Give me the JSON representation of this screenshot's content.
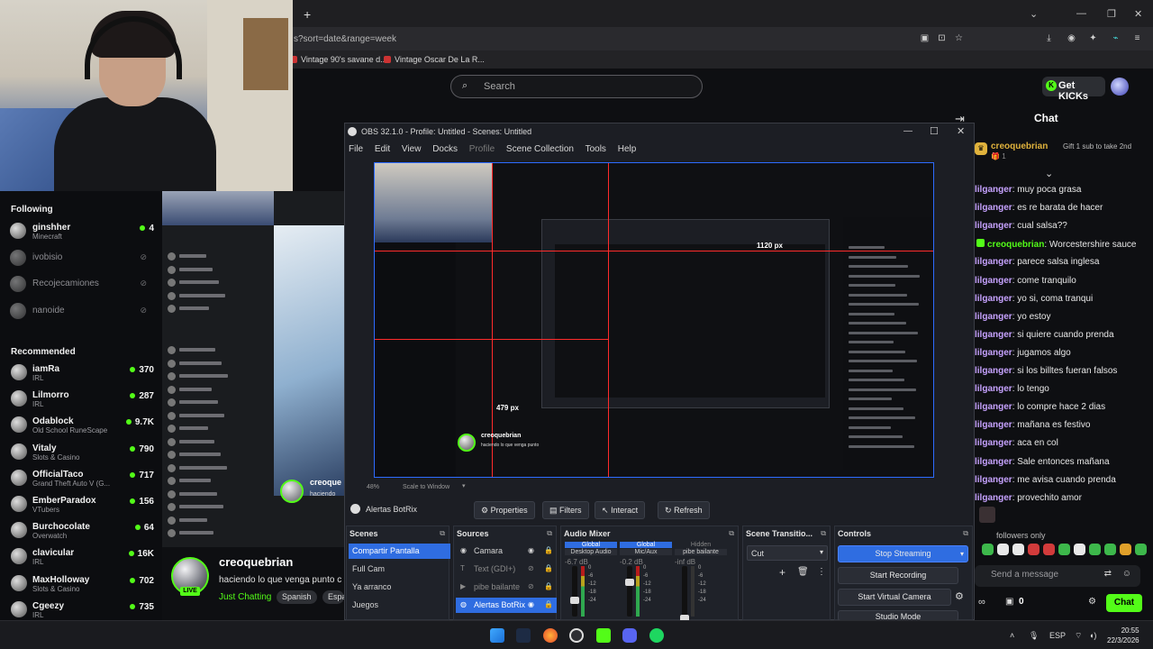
{
  "browser": {
    "url_fragment": "s?sort=date&range=week",
    "bookmarks": [
      "Vintage 90's savane d...",
      "Vintage Oscar De La R..."
    ],
    "new_tab": "+"
  },
  "header": {
    "search_placeholder": "Search",
    "get_kicks_label": "Get KICKs"
  },
  "sidebar": {
    "following_heading": "Following",
    "following": [
      {
        "name": "ginshher",
        "category": "Minecraft",
        "viewers": "4",
        "live": true
      },
      {
        "name": "ivobisio",
        "category": "",
        "viewers": "",
        "live": false
      },
      {
        "name": "Recojecamiones",
        "category": "",
        "viewers": "",
        "live": false
      },
      {
        "name": "nanoide",
        "category": "",
        "viewers": "",
        "live": false
      }
    ],
    "recommended_heading": "Recommended",
    "recommended": [
      {
        "name": "iamRa",
        "category": "IRL",
        "viewers": "370"
      },
      {
        "name": "Lilmorro",
        "category": "IRL",
        "viewers": "287"
      },
      {
        "name": "Odablock",
        "category": "Old School RuneScape",
        "viewers": "9.7K"
      },
      {
        "name": "Vitaly",
        "category": "Slots & Casino",
        "viewers": "790"
      },
      {
        "name": "OfficialTaco",
        "category": "Grand Theft Auto V (G...",
        "viewers": "717"
      },
      {
        "name": "EmberParadox",
        "category": "VTubers",
        "viewers": "156"
      },
      {
        "name": "Burchocolate",
        "category": "Overwatch",
        "viewers": "64"
      },
      {
        "name": "clavicular",
        "category": "IRL",
        "viewers": "16K"
      },
      {
        "name": "MaxHolloway",
        "category": "Slots & Casino",
        "viewers": "702"
      },
      {
        "name": "Cgeezy",
        "category": "IRL",
        "viewers": "735"
      }
    ]
  },
  "stream": {
    "channel": "creoquebrian",
    "title": "haciendo lo que venga punto c",
    "category": "Just Chatting",
    "tags": [
      "Spanish",
      "Espa"
    ],
    "live_label": "LIVE",
    "mirror_label": "creoque",
    "mirror_sub": "haciendo"
  },
  "chat": {
    "title": "Chat",
    "pinned": {
      "user": "creoquebrian",
      "sub": "1",
      "gift_text": "Gift 1 sub to take 2nd"
    },
    "messages": [
      {
        "user": "lilganger",
        "text": "muy poca grasa"
      },
      {
        "user": "lilganger",
        "text": "es re barata de hacer"
      },
      {
        "user": "lilganger",
        "text": "cual salsa??"
      },
      {
        "user": "creoquebrian",
        "text": "Worcestershire sauce"
      },
      {
        "user": "lilganger",
        "text": "parece salsa inglesa"
      },
      {
        "user": "lilganger",
        "text": "come tranquilo"
      },
      {
        "user": "lilganger",
        "text": "yo si, coma tranqui"
      },
      {
        "user": "lilganger",
        "text": "yo estoy"
      },
      {
        "user": "lilganger",
        "text": "si quiere cuando prenda"
      },
      {
        "user": "lilganger",
        "text": "jugamos algo"
      },
      {
        "user": "lilganger",
        "text": "si los billtes fueran falsos"
      },
      {
        "user": "lilganger",
        "text": "lo tengo"
      },
      {
        "user": "lilganger",
        "text": "lo compre hace 2 dias"
      },
      {
        "user": "lilganger",
        "text": "mañana es festivo"
      },
      {
        "user": "lilganger",
        "text": "aca en col"
      },
      {
        "user": "lilganger",
        "text": "Sale entonces mañana"
      },
      {
        "user": "lilganger",
        "text": "me avisa cuando prenda"
      },
      {
        "user": "lilganger",
        "text": "provechito amor"
      }
    ],
    "followers_only": "followers only",
    "input_placeholder": "Send a message",
    "kicks_count": "0",
    "send_label": "Chat"
  },
  "obs": {
    "title": "OBS 32.1.0 - Profile: Untitled - Scenes: Untitled",
    "menu": [
      "File",
      "Edit",
      "View",
      "Docks",
      "Profile",
      "Scene Collection",
      "Tools",
      "Help"
    ],
    "preview_labels": {
      "width": "1120 px",
      "height": "479 px",
      "mirror_channel": "creoquebrian",
      "mirror_title": "haciendo lo que venga punto"
    },
    "zoom": "48%",
    "scale_label": "Scale to Window",
    "source_name": "Alertas BotRix",
    "source_buttons": [
      "Properties",
      "Filters",
      "Interact",
      "Refresh"
    ],
    "docks": {
      "scenes": {
        "title": "Scenes",
        "items": [
          "Compartir Pantalla",
          "Full Cam",
          "Ya arranco",
          "Juegos"
        ],
        "selected": 0
      },
      "sources": {
        "title": "Sources",
        "items": [
          "Camara",
          "Text (GDI+)",
          "pibe bailante",
          "Alertas BotRix"
        ],
        "selected": 3
      },
      "mixer": {
        "title": "Audio Mixer",
        "channels": [
          {
            "name": "Desktop Audio",
            "db": "-6.7 dB",
            "group": "Global"
          },
          {
            "name": "Mic/Aux",
            "db": "-0.2 dB",
            "group": "Global"
          },
          {
            "name": "pibe bailante",
            "db": "-inf dB",
            "group": "Hidden"
          }
        ],
        "scale": [
          "0",
          "-6",
          "-12",
          "-18",
          "-24"
        ]
      },
      "transitions": {
        "title": "Scene Transitio...",
        "selected": "Cut"
      },
      "controls": {
        "title": "Controls",
        "buttons": [
          "Stop Streaming",
          "Start Recording",
          "Start Virtual Camera",
          "Studio Mode"
        ]
      }
    }
  },
  "taskbar": {
    "tray_lang": "ESP",
    "time": "20:55",
    "date": "22/3/2026"
  },
  "colors": {
    "kick_green": "#53fc18",
    "obs_blue": "#2f6de1",
    "measure_red": "#ff2b2b"
  }
}
